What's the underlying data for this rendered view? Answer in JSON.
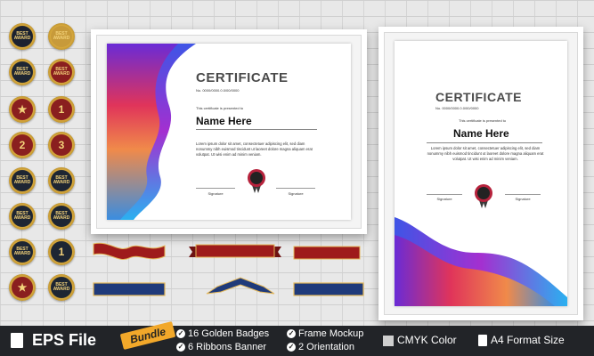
{
  "certificates": [
    {
      "title": "CERTIFICATE",
      "number": "No. 0000/0000.0.0/00/0000",
      "presented": "This certificate is presented to",
      "name": "Name Here",
      "lorem": "Lorem ipsum dolor sit amet, consectetuer adipiscing elit, sed diam nonummy nibh euismod tincidunt ut laoreet dolore magna aliquam erat volutpat. Ut wisi enim ad minim veniam.",
      "sig_left": "Signature",
      "sig_right": "Signature",
      "seal_text": "BEST AWARD"
    },
    {
      "title": "CERTIFICATE",
      "number": "No. 0000/0000.0.0/00/0000",
      "presented": "This certificate is presented to",
      "name": "Name Here",
      "lorem": "Lorem ipsum dolor sit amet, consectetuer adipiscing elit, sed diam nonummy nibh euismod tincidunt ut laoreet dolore magna aliquam erat volutpat. Ut wisi enim ad minim veniam.",
      "sig_left": "Signature",
      "sig_right": "Signature",
      "seal_text": "BEST AWARD"
    }
  ],
  "badges": [
    {
      "kind": "text",
      "text": "BEST AWARD",
      "color": "#1c2230"
    },
    {
      "kind": "text",
      "text": "BEST AWARD",
      "color": "#c79a3a"
    },
    {
      "kind": "text",
      "text": "BEST AWARD",
      "color": "#1e2633"
    },
    {
      "kind": "text",
      "text": "BEST AWARD",
      "color": "#8a1f1f"
    },
    {
      "kind": "star",
      "text": "★",
      "color": "#8a1f1f"
    },
    {
      "kind": "num",
      "text": "1",
      "color": "#8a1f1f"
    },
    {
      "kind": "num",
      "text": "2",
      "color": "#8a1f1f"
    },
    {
      "kind": "num",
      "text": "3",
      "color": "#8a1f1f"
    },
    {
      "kind": "text",
      "text": "BEST AWARD",
      "color": "#1e2633"
    },
    {
      "kind": "text",
      "text": "BEST AWARD",
      "color": "#1e2633"
    },
    {
      "kind": "text",
      "text": "BEST AWARD",
      "color": "#1e2633"
    },
    {
      "kind": "text",
      "text": "BEST AWARD",
      "color": "#1e2633"
    },
    {
      "kind": "text",
      "text": "BEST AWARD",
      "color": "#1e2633"
    },
    {
      "kind": "num",
      "text": "1",
      "color": "#1e2633"
    },
    {
      "kind": "star",
      "text": "★",
      "color": "#8a1f1f"
    },
    {
      "kind": "text",
      "text": "BEST AWARD",
      "color": "#1e2633"
    }
  ],
  "ribbons": [
    {
      "color": "#9e1b1b",
      "shape": "wave"
    },
    {
      "color": "#9e1b1b",
      "shape": "banner"
    },
    {
      "color": "#9e1b1b",
      "shape": "flat"
    },
    {
      "color": "#1f3a7a",
      "shape": "flat"
    },
    {
      "color": "#1f3a7a",
      "shape": "peak"
    },
    {
      "color": "#1f3a7a",
      "shape": "flat"
    }
  ],
  "bar": {
    "file_label": "EPS File",
    "bundle_label": "Bundle",
    "feature1": "16 Golden Badges",
    "feature2": "Frame Mockup",
    "feature3": "6  Ribbons Banner",
    "feature4": "2 Orientation",
    "cmyk": "CMYK Color",
    "a4": "A4 Format Size"
  },
  "colors": {
    "bar_bg": "#222428",
    "bundle": "#f2a82a",
    "gold": "#f3d27a"
  }
}
